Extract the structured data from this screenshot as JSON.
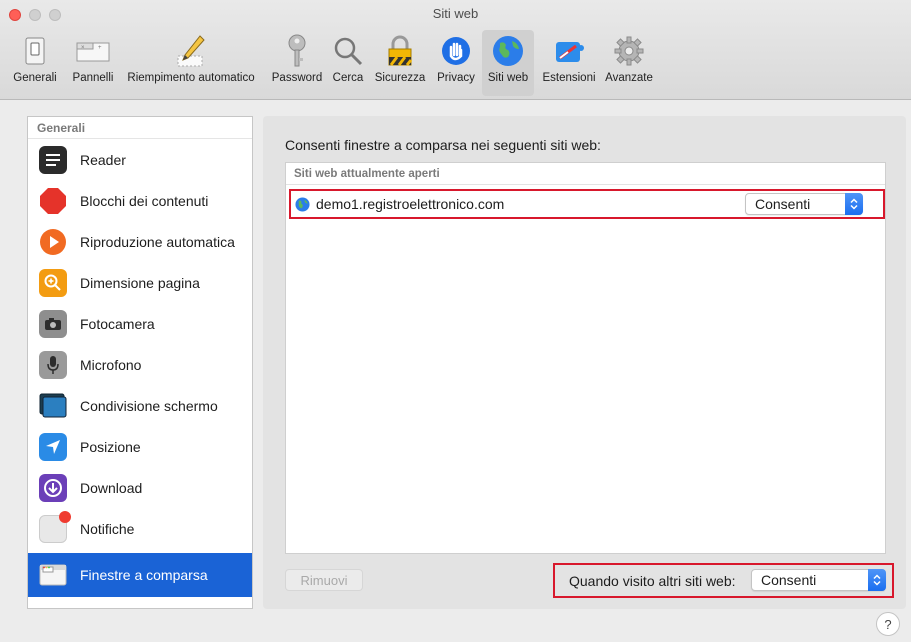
{
  "window": {
    "title": "Siti web"
  },
  "toolbar": {
    "items": [
      {
        "label": "Generali",
        "icon": "switch-icon"
      },
      {
        "label": "Pannelli",
        "icon": "tabs-icon"
      },
      {
        "label": "Riempimento automatico",
        "icon": "pencil-icon"
      },
      {
        "label": "Password",
        "icon": "key-icon"
      },
      {
        "label": "Cerca",
        "icon": "magnifier-icon"
      },
      {
        "label": "Sicurezza",
        "icon": "lock-icon"
      },
      {
        "label": "Privacy",
        "icon": "hand-icon"
      },
      {
        "label": "Siti web",
        "icon": "globe-icon",
        "selected": true
      },
      {
        "label": "Estensioni",
        "icon": "puzzle-icon"
      },
      {
        "label": "Avanzate",
        "icon": "gear-icon"
      }
    ]
  },
  "sidebar": {
    "header": "Generali",
    "items": [
      {
        "label": "Reader",
        "icon": "reader-icon"
      },
      {
        "label": "Blocchi dei contenuti",
        "icon": "stop-icon"
      },
      {
        "label": "Riproduzione automatica",
        "icon": "play-icon"
      },
      {
        "label": "Dimensione pagina",
        "icon": "zoom-icon"
      },
      {
        "label": "Fotocamera",
        "icon": "camera-icon"
      },
      {
        "label": "Microfono",
        "icon": "microphone-icon"
      },
      {
        "label": "Condivisione schermo",
        "icon": "screen-share-icon"
      },
      {
        "label": "Posizione",
        "icon": "location-icon"
      },
      {
        "label": "Download",
        "icon": "download-icon"
      },
      {
        "label": "Notifiche",
        "icon": "notification-icon"
      },
      {
        "label": "Finestre a comparsa",
        "icon": "popup-window-icon",
        "active": true
      }
    ]
  },
  "main": {
    "title": "Consenti finestre a comparsa nei seguenti siti web:",
    "table_header": "Siti web attualmente aperti",
    "rows": [
      {
        "domain": "demo1.registroelettronico.com",
        "setting": "Consenti"
      }
    ],
    "remove_label": "Rimuovi",
    "other_sites_label": "Quando visito altri siti web:",
    "other_sites_value": "Consenti"
  },
  "help_label": "?",
  "colors": {
    "accent": "#1a63d6",
    "highlight_box": "#d8182c"
  }
}
